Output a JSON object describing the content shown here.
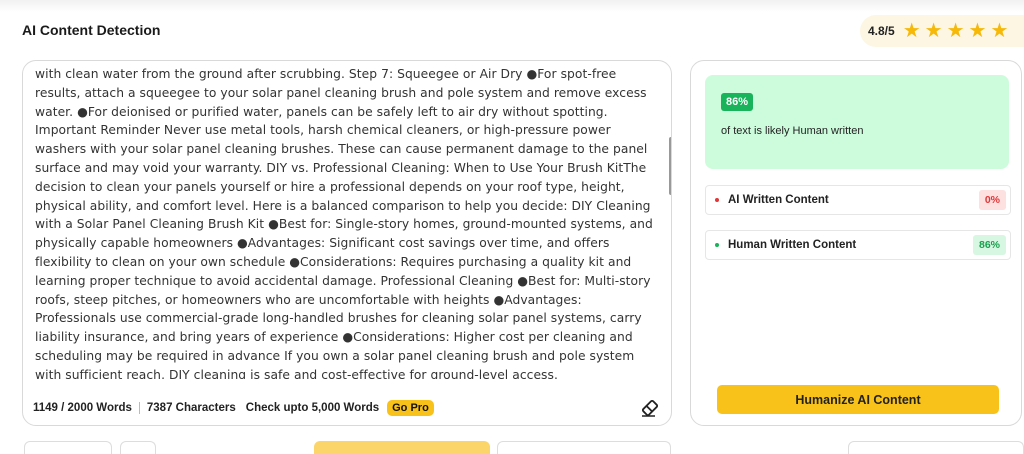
{
  "header": {
    "title": "AI Content Detection",
    "rating": "4.8/5",
    "stars": 5
  },
  "editor": {
    "text": "with clean water from the ground after scrubbing. Step 7: Squeegee or Air Dry ●For spot-free results, attach a squeegee to your solar panel cleaning brush and pole system and remove excess water. ●For deionised or purified water, panels can be safely left to air dry without spotting. Important Reminder Never use metal tools, harsh chemical cleaners, or high-pressure power washers with your solar panel cleaning brushes. These can cause permanent damage to the panel surface and may void your warranty. DIY vs. Professional Cleaning: When to Use Your Brush KitThe decision to clean your panels yourself or hire a professional depends on your roof type, height, physical ability, and comfort level. Here is a balanced comparison to help you decide: DIY Cleaning with a Solar Panel Cleaning Brush Kit ●Best for: Single-story homes, ground-mounted systems, and physically capable homeowners ●Advantages: Significant cost savings over time, and offers flexibility to clean on your own schedule ●Considerations: Requires purchasing a quality kit and learning proper technique to avoid accidental damage. Professional Cleaning ●Best for: Multi-story roofs, steep pitches, or homeowners who are uncomfortable with heights ●Advantages: Professionals use commercial-grade long-handled brushes for cleaning solar panel systems, carry liability insurance, and bring years of experience ●Considerations: Higher cost per cleaning and scheduling may be required in advance If you own a solar panel cleaning brush and pole system with sufficient reach, DIY cleaning is safe and cost-effective for ground-level access.",
    "word_count": "1149 / 2000 Words",
    "char_count": "7387 Characters",
    "limit_text": "Check upto 5,000 Words",
    "go_pro_label": "Go Pro",
    "clear_icon": "eraser-icon"
  },
  "results": {
    "headline_percent": "86%",
    "headline_text": "of text is likely Human written",
    "rows": [
      {
        "label": "AI Written Content",
        "value": "0%",
        "color": "#e23636"
      },
      {
        "label": "Human Written Content",
        "value": "86%",
        "color": "#18b35a"
      }
    ],
    "humanize_label": "Humanize AI Content"
  },
  "colors": {
    "accent": "#f8c21a",
    "human_green": "#18b35a",
    "ai_red": "#e23636",
    "result_bg": "#cdfcdc"
  }
}
